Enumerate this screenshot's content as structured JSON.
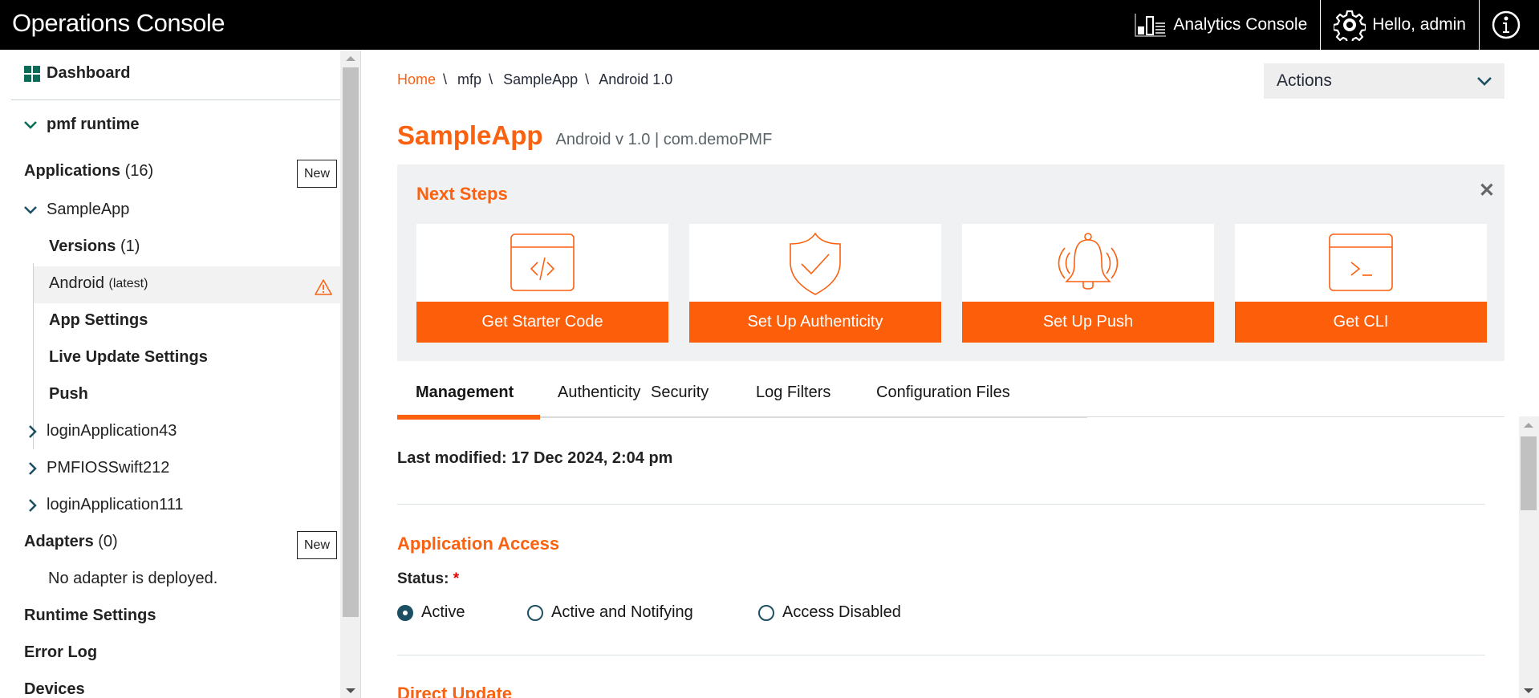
{
  "header": {
    "title": "Operations Console",
    "analytics_label": "Analytics Console",
    "user_label": "Hello, admin"
  },
  "sidebar": {
    "dashboard": "Dashboard",
    "runtime": "pmf runtime",
    "applications_label": "Applications",
    "applications_count": "(16)",
    "new_label": "New",
    "apps": [
      {
        "name": "SampleApp",
        "expanded": true
      },
      {
        "name": "loginApplication43",
        "expanded": false
      },
      {
        "name": "PMFIOSSwift212",
        "expanded": false
      },
      {
        "name": "loginApplication111",
        "expanded": false
      }
    ],
    "versions_label": "Versions",
    "versions_count": "(1)",
    "version_item": "Android",
    "version_tag": "(latest)",
    "app_settings": "App Settings",
    "live_update": "Live Update Settings",
    "push": "Push",
    "adapters_label": "Adapters",
    "adapters_count": "(0)",
    "no_adapter": "No adapter is deployed.",
    "runtime_settings": "Runtime Settings",
    "error_log": "Error Log",
    "devices": "Devices"
  },
  "breadcrumb": [
    "Home",
    "mfp",
    "SampleApp",
    "Android 1.0"
  ],
  "actions_label": "Actions",
  "app": {
    "name": "SampleApp",
    "meta": "Android v 1.0 | com.demoPMF"
  },
  "next_steps": {
    "title": "Next Steps",
    "cards": [
      {
        "label": "Get Starter Code",
        "icon": "code-window-icon"
      },
      {
        "label": "Set Up Authenticity",
        "icon": "shield-check-icon"
      },
      {
        "label": "Set Up Push",
        "icon": "bell-icon"
      },
      {
        "label": "Get CLI",
        "icon": "terminal-icon"
      }
    ]
  },
  "tabs": [
    {
      "label": "Management",
      "active": true
    },
    {
      "label": "Authenticity",
      "active": false
    },
    {
      "label": "Security",
      "active": false
    },
    {
      "label": "Log Filters",
      "active": false
    },
    {
      "label": "Configuration Files",
      "active": false
    }
  ],
  "management": {
    "last_modified": "Last modified: 17 Dec 2024, 2:04 pm",
    "access_title": "Application Access",
    "status_label": "Status:",
    "required_mark": "*",
    "status_options": [
      {
        "label": "Active",
        "selected": true
      },
      {
        "label": "Active and Notifying",
        "selected": false
      },
      {
        "label": "Access Disabled",
        "selected": false
      }
    ],
    "direct_update_title": "Direct Update"
  },
  "colors": {
    "accent": "#fa6110",
    "button": "#fd5e0a",
    "teal": "#1d4f63",
    "dashboard_icon": "#0b6b57"
  }
}
